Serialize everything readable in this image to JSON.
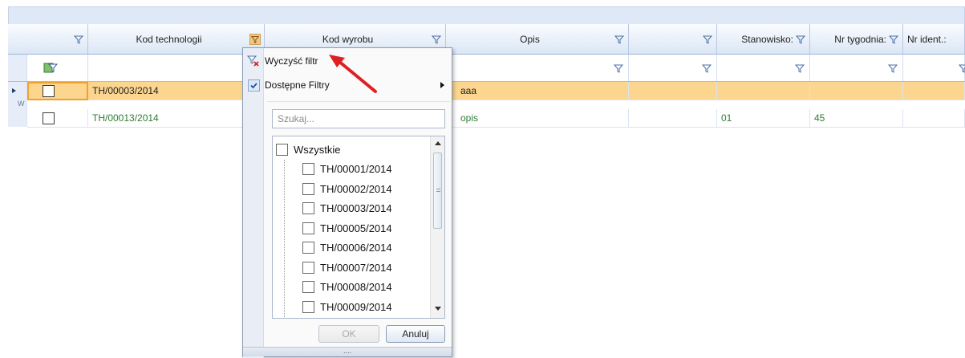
{
  "colors": {
    "header_bg": "#dbe6f5",
    "selected_row": "#fcd58e",
    "text_green": "#2e7d32",
    "arrow_red": "#e02020",
    "filter_active": "#f2c77f"
  },
  "grid": {
    "columns": [
      {
        "label": ""
      },
      {
        "label": "Kod technologii"
      },
      {
        "label": "Kod wyrobu"
      },
      {
        "label": "Opis"
      },
      {
        "label": ""
      },
      {
        "label": "Stanowisko:"
      },
      {
        "label": "Nr tygodnia:"
      },
      {
        "label": "Nr ident.:"
      }
    ],
    "rows": [
      {
        "kod": "TH/00003/2014",
        "opis": "aaa",
        "stanowisko": "",
        "tydzien": ""
      },
      {
        "kod": "TH/00013/2014",
        "opis": "opis",
        "stanowisko": "01",
        "tydzien": "45"
      }
    ],
    "side_letter": "W"
  },
  "popup": {
    "menu": {
      "clear_filter": "Wyczyść filtr",
      "available_filters": "Dostępne Filtry"
    },
    "search_placeholder": "Szukaj...",
    "list": {
      "all": "Wszystkie",
      "items": [
        "TH/00001/2014",
        "TH/00002/2014",
        "TH/00003/2014",
        "TH/00005/2014",
        "TH/00006/2014",
        "TH/00007/2014",
        "TH/00008/2014",
        "TH/00009/2014"
      ]
    },
    "buttons": {
      "ok": "OK",
      "cancel": "Anuluj"
    },
    "grip": "...."
  }
}
